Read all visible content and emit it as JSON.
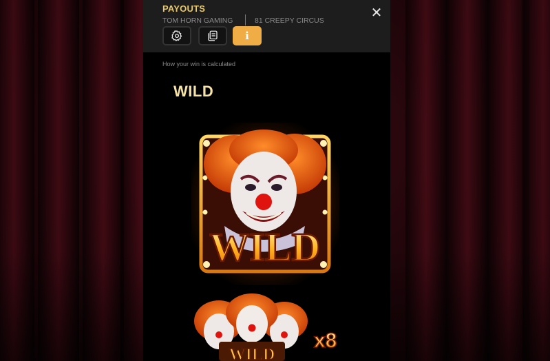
{
  "header": {
    "title": "PAYOUTS",
    "provider": "TOM HORN GAMING",
    "game": "81 CREEPY CIRCUS",
    "tabs": [
      {
        "name": "settings",
        "icon": "gear-icon",
        "active": false
      },
      {
        "name": "history",
        "icon": "history-icon",
        "active": false
      },
      {
        "name": "info",
        "icon": "info-icon",
        "active": true
      }
    ],
    "info_glyph": "i",
    "close_glyph": "✕"
  },
  "content": {
    "subtitle": "How your win is calculated",
    "section_title": "WILD",
    "wild_symbol": {
      "label": "WILD",
      "image": "clown-wild-symbol"
    },
    "wild_multiplier": {
      "label": "WILD",
      "multiplier": "x8",
      "image": "clown-group-wild-symbol"
    }
  },
  "colors": {
    "accent": "#f0ad45",
    "title": "#e8c86a",
    "section_title": "#f6e3a3",
    "muted": "#8a8a8a",
    "panel_bg": "#000000",
    "header_bg": "#1d1d1d"
  }
}
